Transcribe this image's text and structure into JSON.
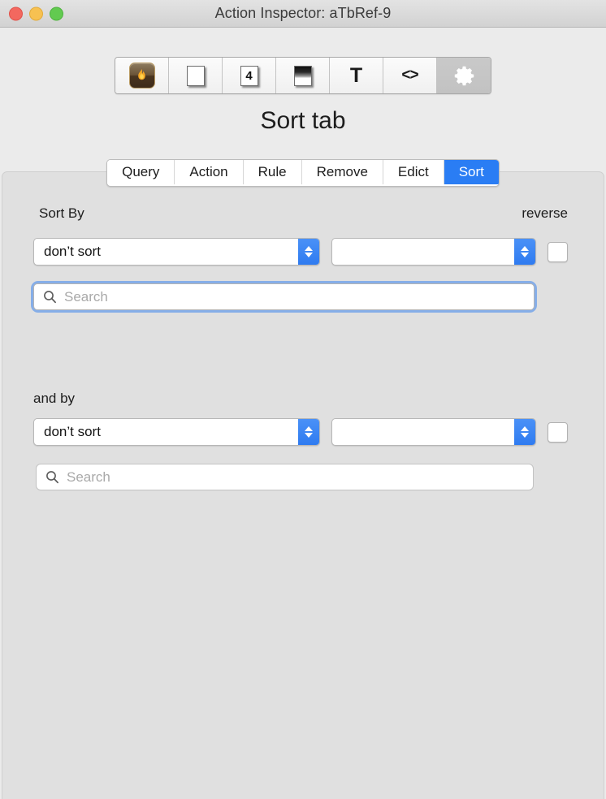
{
  "window": {
    "title": "Action Inspector: aTbRef-9",
    "traffic_lights": [
      "close",
      "minimize",
      "maximize"
    ]
  },
  "toolbar": {
    "buttons": [
      {
        "name": "fire-icon",
        "label": "",
        "glyph": "flame",
        "selected": false
      },
      {
        "name": "blank-card-icon",
        "label": "",
        "glyph": "card",
        "selected": false
      },
      {
        "name": "card-four-icon",
        "label": "4",
        "glyph": "card-num",
        "selected": false
      },
      {
        "name": "gradient-card-icon",
        "label": "",
        "glyph": "card-grad",
        "selected": false
      },
      {
        "name": "text-icon",
        "label": "T",
        "glyph": "text",
        "selected": false
      },
      {
        "name": "code-icon",
        "label": "<>",
        "glyph": "code",
        "selected": false
      },
      {
        "name": "gear-icon",
        "label": "",
        "glyph": "gear",
        "selected": true
      }
    ]
  },
  "page": {
    "title": "Sort tab"
  },
  "tabs": {
    "items": [
      {
        "label": "Query",
        "active": false
      },
      {
        "label": "Action",
        "active": false
      },
      {
        "label": "Rule",
        "active": false
      },
      {
        "label": "Remove",
        "active": false
      },
      {
        "label": "Edict",
        "active": false
      },
      {
        "label": "Sort",
        "active": true
      }
    ]
  },
  "sort_panel": {
    "primary": {
      "label": "Sort By",
      "reverse_label": "reverse",
      "attribute_value": "don’t sort",
      "order_value": "",
      "reverse_checked": false,
      "search_placeholder": "Search",
      "search_value": "",
      "search_focused": true
    },
    "secondary": {
      "label": "and by",
      "attribute_value": "don’t sort",
      "order_value": "",
      "reverse_checked": false,
      "search_placeholder": "Search",
      "search_value": "",
      "search_focused": false
    }
  },
  "colors": {
    "accent_blue": "#2a7df4",
    "stepper_blue": "#2f7bf0",
    "focus_ring": "#86aee8",
    "window_bg": "#ebebeb",
    "panel_bg": "#e0e0e0"
  }
}
